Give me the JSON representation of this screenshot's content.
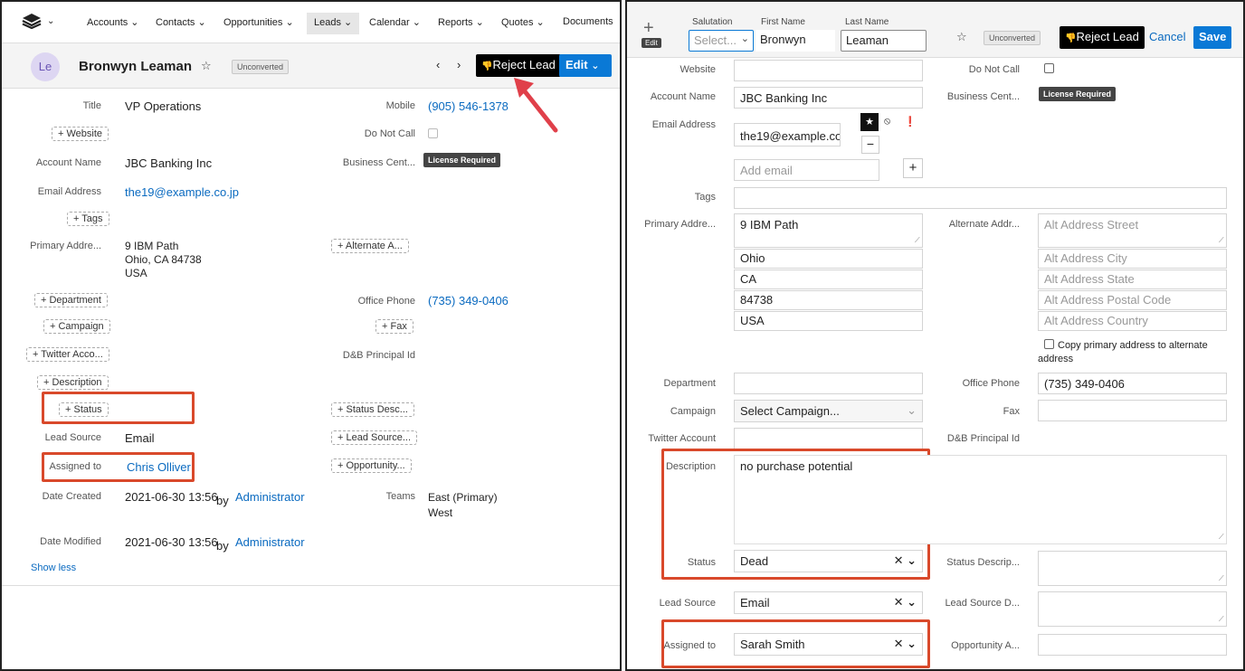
{
  "left": {
    "nav": {
      "items": [
        "Accounts",
        "Contacts",
        "Opportunities",
        "Leads",
        "Calendar",
        "Reports",
        "Quotes",
        "Documents"
      ],
      "active": "Leads"
    },
    "header": {
      "avatar": "Le",
      "name": "Bronwyn Leaman",
      "badge": "Unconverted",
      "reject_label": "Reject Lead",
      "edit_label": "Edit"
    },
    "fields": {
      "title_label": "Title",
      "title_value": "VP Operations",
      "mobile_label": "Mobile",
      "mobile_value": "(905) 546-1378",
      "website_pill": "+ Website",
      "donotcall_label": "Do Not Call",
      "account_label": "Account Name",
      "account_value": "JBC Banking Inc",
      "business_label": "Business Cent...",
      "license": "License Required",
      "email_label": "Email Address",
      "email_value": "the19@example.co.jp",
      "tags_pill": "+ Tags",
      "primary_label": "Primary Addre...",
      "addr1": "9 IBM Path",
      "addr2": "Ohio, CA 84738",
      "addr3": "USA",
      "alternate_pill": "+ Alternate A...",
      "department_pill": "+ Department",
      "office_label": "Office Phone",
      "office_value": "(735) 349-0406",
      "campaign_pill": "+ Campaign",
      "fax_pill": "+ Fax",
      "twitter_pill": "+ Twitter Acco...",
      "dnb_label": "D&B Principal Id",
      "description_pill": "+ Description",
      "status_pill": "+ Status",
      "status_desc_pill": "+ Status Desc...",
      "lead_source_label": "Lead Source",
      "lead_source_value": "Email",
      "lead_source_pill": "+ Lead Source...",
      "assigned_label": "Assigned to",
      "assigned_value": "Chris Olliver",
      "opportunity_pill": "+ Opportunity...",
      "created_label": "Date Created",
      "created_value": "2021-06-30 13:56",
      "by": "by",
      "created_by": "Administrator",
      "teams_label": "Teams",
      "team1": "East (Primary)",
      "team2": "West",
      "modified_label": "Date Modified",
      "modified_value": "2021-06-30 13:56",
      "modified_by": "Administrator",
      "show_less": "Show less"
    }
  },
  "right": {
    "header": {
      "salutation_label": "Salutation",
      "salutation_placeholder": "Select...",
      "first_label": "First Name",
      "first_value": "Bronwyn",
      "last_label": "Last Name",
      "last_value": "Leaman",
      "edit_tag": "Edit",
      "badge": "Unconverted",
      "reject_label": "Reject Lead",
      "cancel_label": "Cancel",
      "save_label": "Save"
    },
    "fields": {
      "website_label": "Website",
      "donotcall_label": "Do Not Call",
      "account_label": "Account Name",
      "account_value": "JBC Banking Inc",
      "business_label": "Business Cent...",
      "license": "License Required",
      "email_label": "Email Address",
      "email_value": "the19@example.co",
      "add_email_placeholder": "Add email",
      "tags_label": "Tags",
      "primary_label": "Primary Addre...",
      "street": "9 IBM Path",
      "city": "Ohio",
      "state": "CA",
      "postal": "84738",
      "country": "USA",
      "alternate_label": "Alternate Addr...",
      "alt_street": "Alt Address Street",
      "alt_city": "Alt Address City",
      "alt_state": "Alt Address State",
      "alt_postal": "Alt Address Postal Code",
      "alt_country": "Alt Address Country",
      "copy_label": "Copy primary address to alternate address",
      "department_label": "Department",
      "office_label": "Office Phone",
      "office_value": "(735) 349-0406",
      "campaign_label": "Campaign",
      "campaign_placeholder": "Select Campaign...",
      "fax_label": "Fax",
      "twitter_label": "Twitter Account",
      "dnb_label": "D&B Principal Id",
      "description_label": "Description",
      "description_value": "no purchase potential",
      "status_label": "Status",
      "status_value": "Dead",
      "status_desc_label": "Status Descrip...",
      "lead_source_label": "Lead Source",
      "lead_source_value": "Email",
      "lead_source_d_label": "Lead Source D...",
      "assigned_label": "Assigned to",
      "assigned_value": "Sarah Smith",
      "opportunity_label": "Opportunity A..."
    }
  },
  "colors": {
    "accent": "#0a6ac0",
    "highlight": "#d9492b",
    "arrow": "#e0404a"
  }
}
